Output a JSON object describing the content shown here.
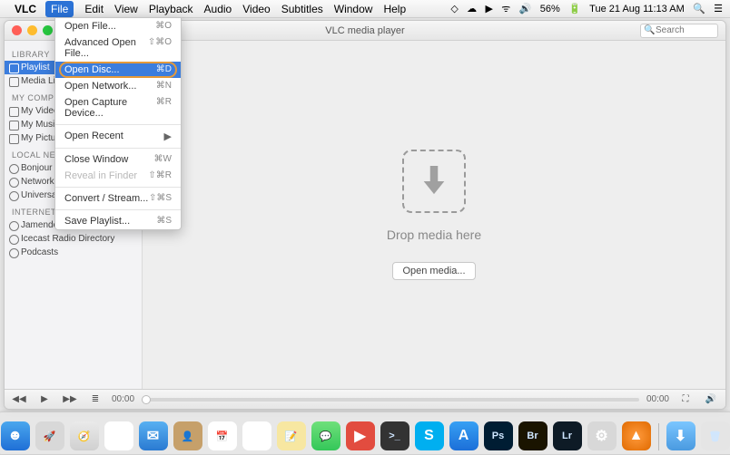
{
  "menubar": {
    "app_name": "VLC",
    "items": [
      "File",
      "Edit",
      "View",
      "Playback",
      "Audio",
      "Video",
      "Subtitles",
      "Window",
      "Help"
    ],
    "open_index": 0,
    "status": {
      "battery": "56%",
      "clock": "Tue 21 Aug  11:13 AM"
    }
  },
  "file_menu": {
    "items": [
      {
        "label": "Open File...",
        "shortcut": "⌘O"
      },
      {
        "label": "Advanced Open File...",
        "shortcut": "⇧⌘O"
      },
      {
        "label": "Open Disc...",
        "shortcut": "⌘D",
        "highlight": true
      },
      {
        "label": "Open Network...",
        "shortcut": "⌘N"
      },
      {
        "label": "Open Capture Device...",
        "shortcut": "⌘R"
      },
      {
        "type": "sep"
      },
      {
        "label": "Open Recent",
        "submenu": true
      },
      {
        "type": "sep"
      },
      {
        "label": "Close Window",
        "shortcut": "⌘W"
      },
      {
        "label": "Reveal in Finder",
        "shortcut": "⇧⌘R",
        "disabled": true
      },
      {
        "type": "sep"
      },
      {
        "label": "Convert / Stream...",
        "shortcut": "⇧⌘S"
      },
      {
        "type": "sep"
      },
      {
        "label": "Save Playlist...",
        "shortcut": "⌘S"
      }
    ]
  },
  "window": {
    "title": "VLC media player",
    "search_placeholder": "Search",
    "drop_text": "Drop media here",
    "open_media_label": "Open media...",
    "time_elapsed": "00:00",
    "time_total": "00:00"
  },
  "sidebar": {
    "groups": [
      {
        "title": "LIBRARY",
        "items": [
          {
            "label": "Playlist",
            "selected": true
          },
          {
            "label": "Media Library"
          }
        ]
      },
      {
        "title": "MY COMPUTER",
        "items": [
          {
            "label": "My Videos"
          },
          {
            "label": "My Music"
          },
          {
            "label": "My Pictures"
          }
        ]
      },
      {
        "title": "LOCAL NETWORK",
        "items": [
          {
            "label": "Bonjour Network",
            "radio": true
          },
          {
            "label": "Network streams",
            "radio": true
          },
          {
            "label": "Universal Plug'n'Play",
            "radio": true
          }
        ]
      },
      {
        "title": "INTERNET",
        "items": [
          {
            "label": "Jamendo Selections",
            "radio": true
          },
          {
            "label": "Icecast Radio Directory",
            "radio": true
          },
          {
            "label": "Podcasts",
            "radio": true
          }
        ]
      }
    ]
  },
  "dock": {
    "apps": [
      {
        "name": "finder",
        "bg": "linear-gradient(#4aa7ee,#1f6fd6)",
        "glyph": "☻"
      },
      {
        "name": "launchpad",
        "bg": "#d8d8d8",
        "glyph": "🚀"
      },
      {
        "name": "safari",
        "bg": "linear-gradient(#eaeaea,#d0d0d0)",
        "glyph": "🧭"
      },
      {
        "name": "chrome",
        "bg": "#fff",
        "glyph": "◉"
      },
      {
        "name": "mail",
        "bg": "linear-gradient(#58b0f2,#2a7ad2)",
        "glyph": "✉"
      },
      {
        "name": "contacts",
        "bg": "#c6a06a",
        "glyph": "👤"
      },
      {
        "name": "calendar",
        "bg": "#fff",
        "glyph": "📅"
      },
      {
        "name": "reminders",
        "bg": "#fff",
        "glyph": "☑"
      },
      {
        "name": "notes",
        "bg": "#f7e7a1",
        "glyph": "📝"
      },
      {
        "name": "messages",
        "bg": "linear-gradient(#6fe07b,#34c759)",
        "glyph": "💬"
      },
      {
        "name": "anydesk",
        "bg": "#e24c3f",
        "glyph": "▶"
      },
      {
        "name": "terminal",
        "bg": "#333",
        "glyph": ">_"
      },
      {
        "name": "skype",
        "bg": "#00aff0",
        "glyph": "S"
      },
      {
        "name": "appstore",
        "bg": "linear-gradient(#37a0f4,#1c6fd8)",
        "glyph": "A"
      },
      {
        "name": "photoshop",
        "bg": "#001d33",
        "glyph": "Ps"
      },
      {
        "name": "bridge",
        "bg": "#1a1400",
        "glyph": "Br"
      },
      {
        "name": "lightroom",
        "bg": "#0e1b26",
        "glyph": "Lr"
      },
      {
        "name": "preferences",
        "bg": "#d8d8d8",
        "glyph": "⚙"
      },
      {
        "name": "vlc",
        "bg": "radial-gradient(#ff9a3c,#e06a00)",
        "glyph": "▲"
      },
      {
        "name": "downloads",
        "bg": "linear-gradient(#7bc6ff,#4a9ae0)",
        "glyph": "⬇"
      },
      {
        "name": "trash",
        "bg": "#e5e5e5",
        "glyph": "🗑"
      }
    ]
  }
}
